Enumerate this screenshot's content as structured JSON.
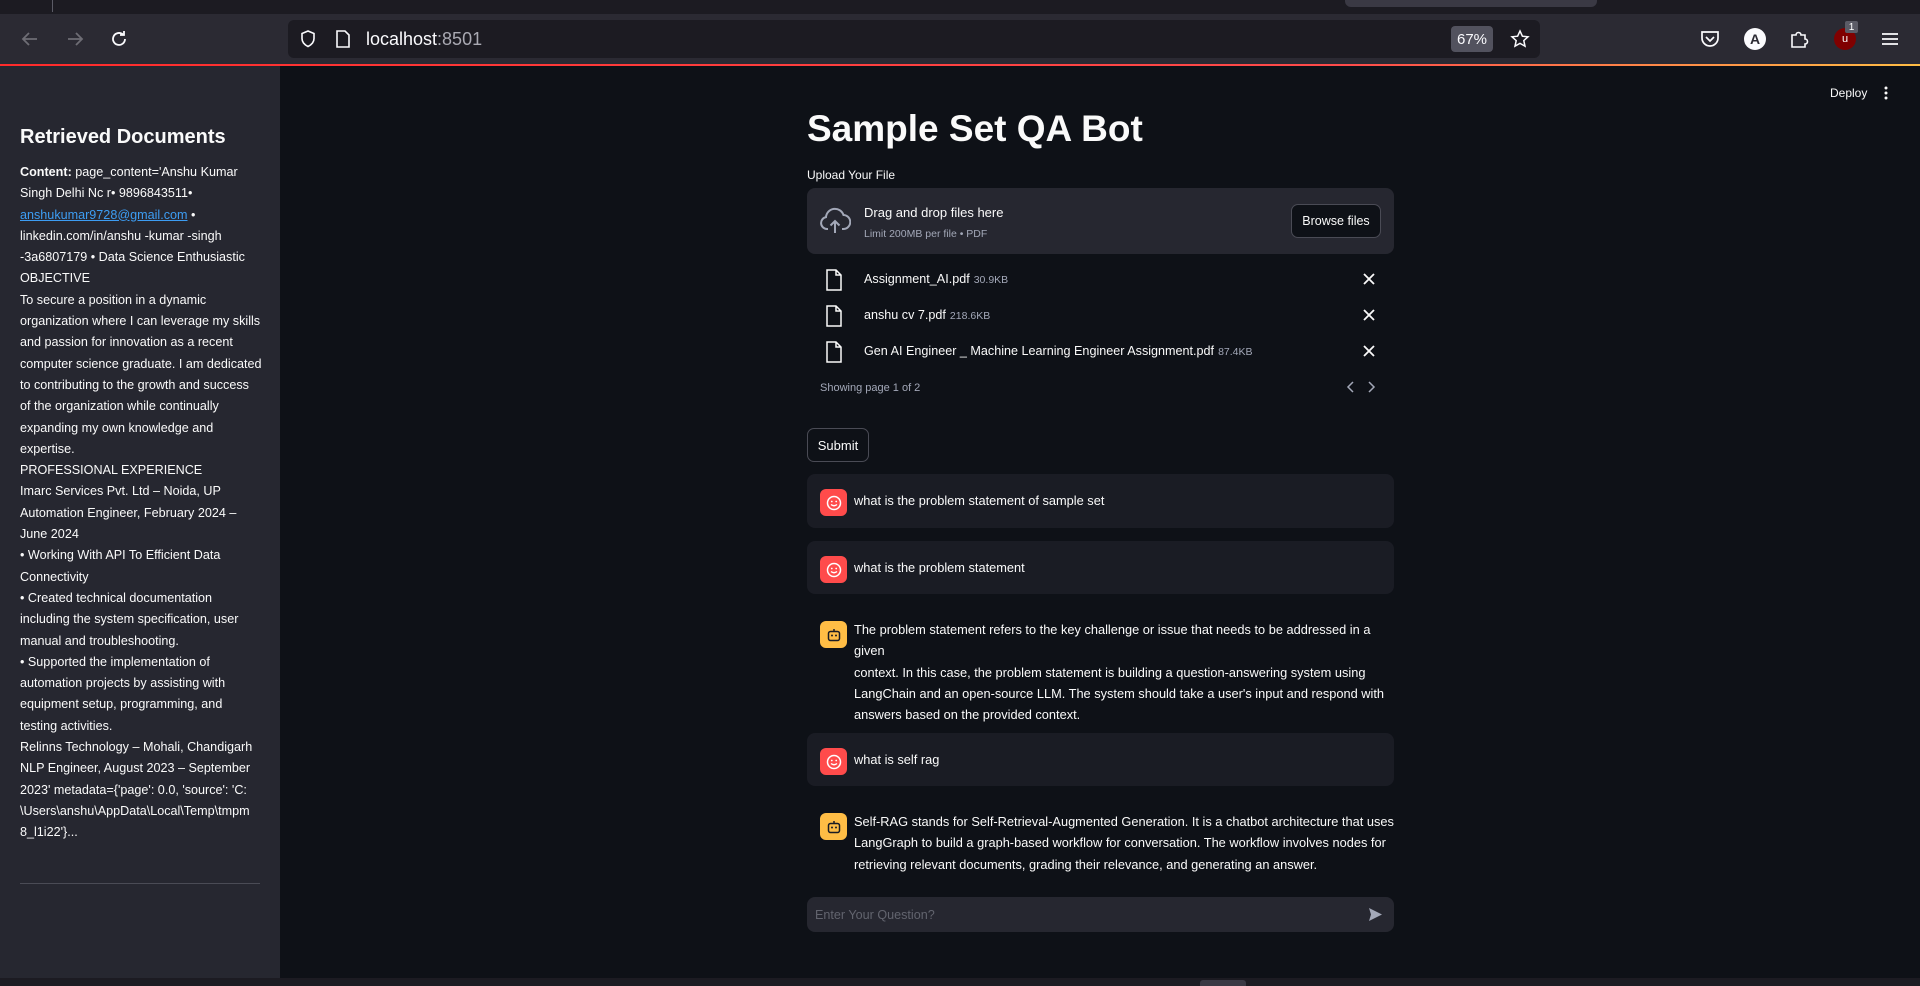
{
  "browser": {
    "url_host": "localhost",
    "url_port": ":8501",
    "zoom": "67%",
    "account_initial": "A",
    "ublock_label": "u",
    "ublock_badge": "1"
  },
  "sidebar": {
    "heading": "Retrieved Documents",
    "content_label": "Content:",
    "line_1": "page_content='Anshu Kumar",
    "lines_top": [
      "Singh Delhi Nc r• 9896843511•"
    ],
    "email": "anshukumar9728@gmail.com",
    "email_suffix": " •",
    "lines": [
      "linkedin.com/in/anshu -kumar -singh",
      "-3a6807179 • Data Science Enthusiastic",
      "OBJECTIVE",
      "To secure a position in a dynamic",
      "organization where I can leverage my skills",
      "and passion for innovation as a recent",
      "computer science graduate. I am dedicated",
      "to contributing to the growth and success",
      "of the organization while continually",
      "expanding my own knowledge and",
      "expertise.",
      "PROFESSIONAL EXPERIENCE",
      "Imarc Services Pvt. Ltd – Noida, UP",
      "Automation Engineer, February 2024 –",
      "June 2024",
      "• Working With API To Efficient Data",
      "Connectivity",
      "• Created technical documentation",
      "including the system specification, user",
      "manual and troubleshooting.",
      "• Supported the implementation of",
      "automation projects by assisting with",
      "equipment setup, programming, and",
      "testing activities.",
      "Relinns Technology – Mohali, Chandigarh",
      "NLP Engineer, August 2023 – September",
      "2023' metadata={'page': 0.0, 'source': 'C:",
      "\\Users\\anshu\\AppData\\Local\\Temp\\tmpm",
      "8_l1i22'}..."
    ]
  },
  "header": {
    "deploy_label": "Deploy"
  },
  "main": {
    "title": "Sample Set QA Bot",
    "upload_label": "Upload Your File",
    "dropzone_title": "Drag and drop files here",
    "dropzone_sub": "Limit 200MB per file • PDF",
    "browse_label": "Browse files",
    "files": [
      {
        "name": "Assignment_AI.pdf",
        "size": "30.9KB"
      },
      {
        "name": "anshu cv 7.pdf",
        "size": "218.6KB"
      },
      {
        "name": "Gen AI Engineer _ Machine Learning Engineer Assignment.pdf",
        "size": "87.4KB"
      }
    ],
    "pager_text": "Showing page 1 of 2",
    "submit_label": "Submit",
    "messages": [
      {
        "role": "user",
        "text": "what is the problem statement of sample set"
      },
      {
        "role": "user",
        "text": "what is the problem statement"
      },
      {
        "role": "assistant",
        "lines": [
          "The problem statement refers to the key challenge or issue that needs to be addressed in a given",
          "context. In this case, the problem statement is building a question-answering system using",
          "LangChain and an open-source LLM. The system should take a user's input and respond with",
          "answers based on the provided context."
        ]
      },
      {
        "role": "user",
        "text": "what is self rag"
      },
      {
        "role": "assistant",
        "lines": [
          "Self-RAG stands for Self-Retrieval-Augmented Generation. It is a chatbot architecture that uses",
          "LangGraph to build a graph-based workflow for conversation. The workflow involves nodes for",
          "retrieving relevant documents, grading their relevance, and generating an answer."
        ]
      }
    ],
    "chat_placeholder": "Enter Your Question?"
  }
}
